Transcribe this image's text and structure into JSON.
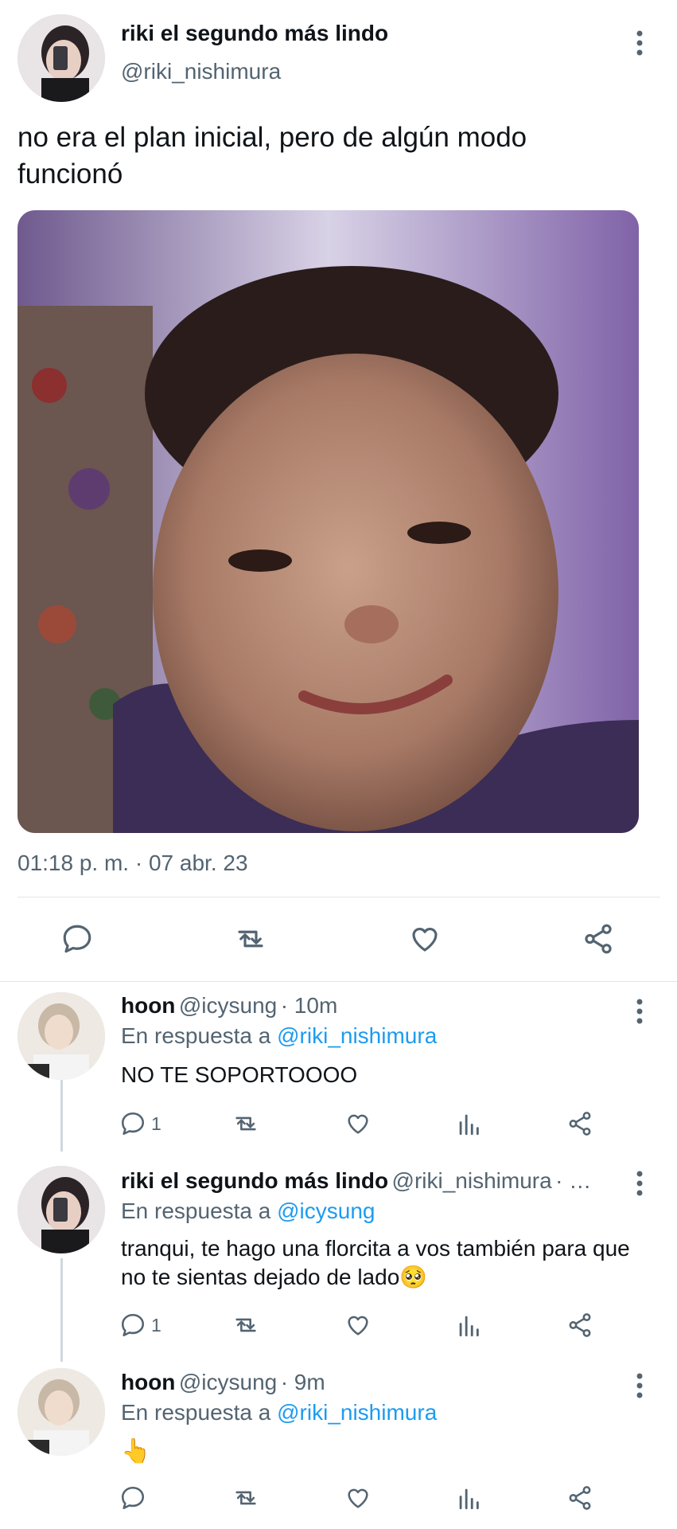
{
  "main_tweet": {
    "display_name": "riki el segundo más lindo",
    "handle": "@riki_nishimura",
    "text": "no era el plan inicial, pero de algún modo funcionó",
    "timestamp": "01:18 p. m. · 07 abr. 23",
    "actions": [
      "reply-icon",
      "retweet-icon",
      "like-icon",
      "share-icon"
    ]
  },
  "replies": [
    {
      "display_name": "hoon",
      "handle": "@icysung",
      "time": "· 10m",
      "reply_prefix": "En respuesta a",
      "reply_to": "@riki_nishimura",
      "text": "NO TE SOPORTOOOO",
      "reply_count": "1"
    },
    {
      "display_name": "riki el segundo más lindo",
      "handle": "@riki_nishimura",
      "time": "· …",
      "reply_prefix": "En respuesta a",
      "reply_to": "@icysung",
      "text": "tranqui, te hago una florcita a vos también para que no te sientas dejado de lado🥺",
      "reply_count": "1"
    },
    {
      "display_name": "hoon",
      "handle": "@icysung",
      "time": "· 9m",
      "reply_prefix": "En respuesta a",
      "reply_to": "@riki_nishimura",
      "text": "👆",
      "reply_count": ""
    }
  ],
  "colors": {
    "accent": "#1d9bf0",
    "muted": "#536471",
    "divider": "#e1e6ea"
  }
}
